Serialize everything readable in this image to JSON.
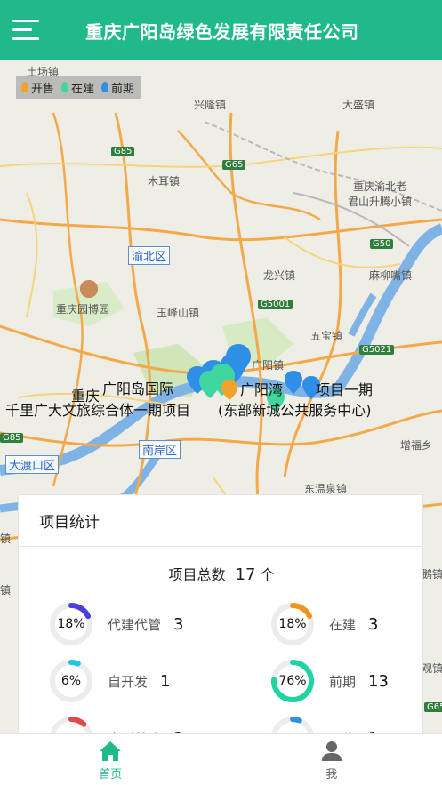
{
  "header": {
    "title": "重庆广阳岛绿色发展有限责任公司",
    "menu_icon": "hamburger-menu-icon"
  },
  "legend": {
    "items": [
      {
        "label": "开售",
        "color": "#f0a22a"
      },
      {
        "label": "在建",
        "color": "#3fd6a0"
      },
      {
        "label": "前期",
        "color": "#2f8fe6"
      }
    ]
  },
  "map": {
    "places": [
      {
        "text": "土场镇",
        "key": "tuchang"
      },
      {
        "text": "兴隆镇",
        "key": "xinglong"
      },
      {
        "text": "大盛镇",
        "key": "dasheng"
      },
      {
        "text": "木耳镇",
        "key": "muer"
      },
      {
        "text": "重庆渝北老",
        "key": "yubei"
      },
      {
        "text": "君山升腾小镇",
        "key": "junshan"
      },
      {
        "text": "龙兴镇",
        "key": "longxing"
      },
      {
        "text": "麻柳嘴镇",
        "key": "maliuzui"
      },
      {
        "text": "重庆园博园",
        "key": "yuanboyuan"
      },
      {
        "text": "玉峰山镇",
        "key": "yufengshan"
      },
      {
        "text": "五宝镇",
        "key": "wubao"
      },
      {
        "text": "广阳镇",
        "key": "guangyang"
      },
      {
        "text": "东温泉镇",
        "key": "dongwenquan"
      },
      {
        "text": "增福乡",
        "key": "zengfu"
      },
      {
        "text": "镇",
        "key": "zhen_left"
      },
      {
        "text": "镇",
        "key": "zhen_left2"
      },
      {
        "text": "鹅镇",
        "key": "ezhen"
      },
      {
        "text": "观镇",
        "key": "guanzhen"
      }
    ],
    "districts": [
      "渝北区",
      "南岸区",
      "大渡口区"
    ],
    "roads": [
      "G85",
      "G65",
      "G50",
      "G5001",
      "G5021",
      "G85",
      "G65"
    ],
    "project_labels": [
      "重庆",
      "广阳岛国际",
      "广阳湾",
      "项目一期",
      "千里广大文旅综合体一期项目",
      "(东部新城公共服务中心)"
    ]
  },
  "stats": {
    "title": "项目统计",
    "total_label": "项目总数",
    "total_count": "17",
    "total_unit": "个",
    "items": [
      {
        "key": "daijian",
        "label": "代建代管",
        "count": "3",
        "pct": "18%",
        "value": 0.18,
        "color": "#4a3fd6"
      },
      {
        "key": "zaijian",
        "label": "在建",
        "count": "3",
        "pct": "18%",
        "value": 0.18,
        "color": "#f0941f"
      },
      {
        "key": "zikaifa",
        "label": "自开发",
        "count": "1",
        "pct": "6%",
        "value": 0.06,
        "color": "#22c3e6"
      },
      {
        "key": "qianqi",
        "label": "前期",
        "count": "13",
        "pct": "76%",
        "value": 0.76,
        "color": "#1fd3a3"
      },
      {
        "key": "row3left",
        "label": "大型基建",
        "count": "2",
        "pct": "",
        "value": 0.12,
        "color": "#e04a4a"
      },
      {
        "key": "row3right",
        "label": "开售",
        "count": "1",
        "pct": "",
        "value": 0.06,
        "color": "#2f8fe6"
      }
    ]
  },
  "nav": {
    "items": [
      {
        "label": "首页",
        "icon": "home-icon",
        "active": true
      },
      {
        "label": "我",
        "icon": "user-icon",
        "active": false
      }
    ]
  }
}
